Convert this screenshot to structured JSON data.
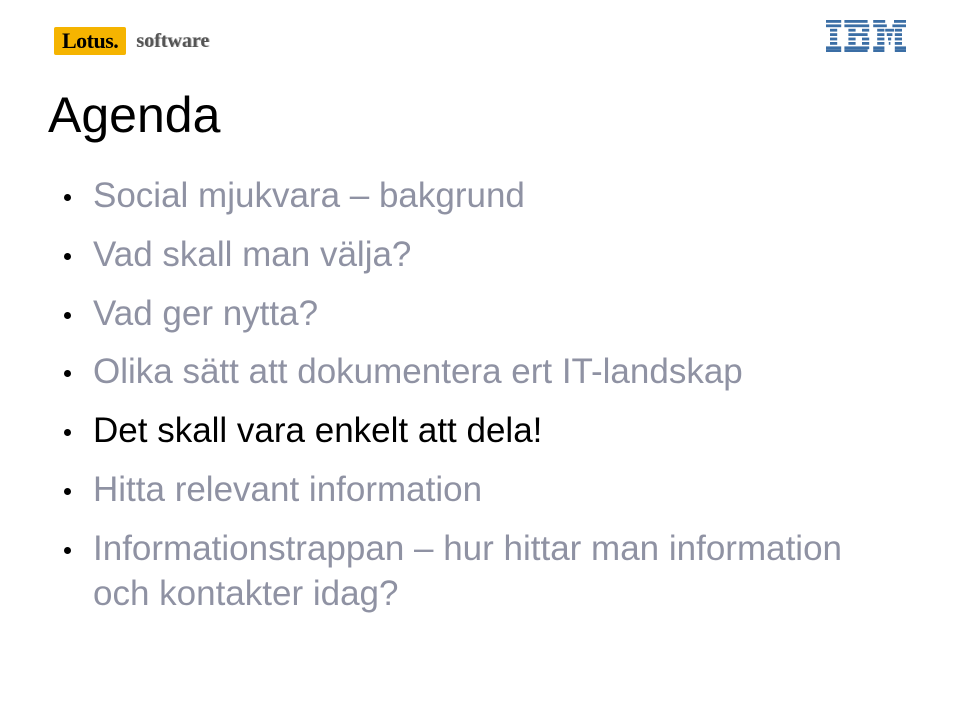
{
  "header": {
    "lotus_text": "Lotus.",
    "software_text": "software",
    "ibm_label": "IBM"
  },
  "title": "Agenda",
  "bullets": [
    {
      "text": "Social mjukvara – bakgrund",
      "emphasis": "muted"
    },
    {
      "text": "Vad skall man välja?",
      "emphasis": "muted"
    },
    {
      "text": "Vad ger nytta?",
      "emphasis": "muted"
    },
    {
      "text": "Olika sätt att dokumentera ert IT-landskap",
      "emphasis": "muted"
    },
    {
      "text": "Det skall vara enkelt att dela!",
      "emphasis": "emph"
    },
    {
      "text": "Hitta relevant information",
      "emphasis": "muted"
    },
    {
      "text": "Informationstrappan – hur hittar man information och kontakter idag?",
      "emphasis": "muted"
    }
  ]
}
